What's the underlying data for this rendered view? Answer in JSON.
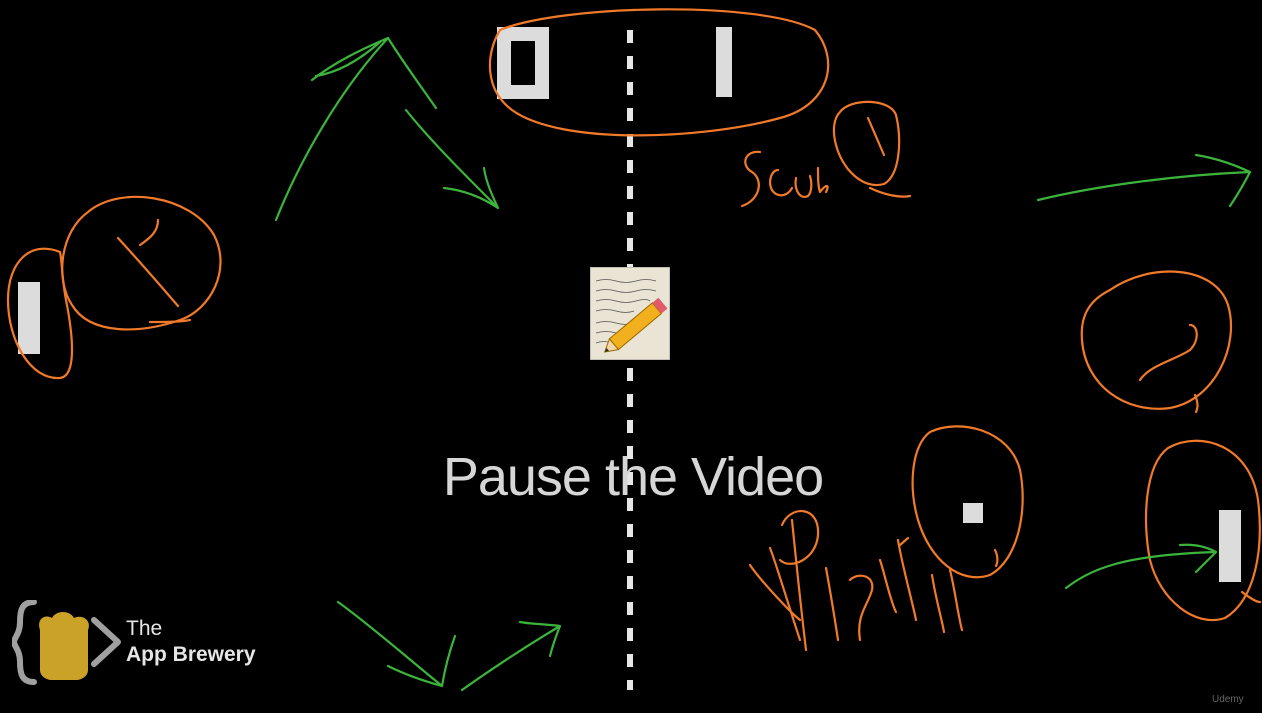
{
  "slide": {
    "title": "Pause the Video",
    "score_left": "0",
    "score_right": "1"
  },
  "annotations": {
    "score_note": "Score",
    "ball_note": "Ball"
  },
  "branding": {
    "logo_line1": "The",
    "logo_line2": "App Brewery",
    "watermark": "Udemy"
  },
  "colors": {
    "background": "#000000",
    "foreground": "#dcdcdc",
    "annotation_orange": "#f07a2a",
    "annotation_green": "#3cb43c",
    "logo_gold": "#c9a227"
  },
  "icons": {
    "notepad": "notepad-pencil-icon",
    "logo": "app-brewery-logo-icon"
  }
}
